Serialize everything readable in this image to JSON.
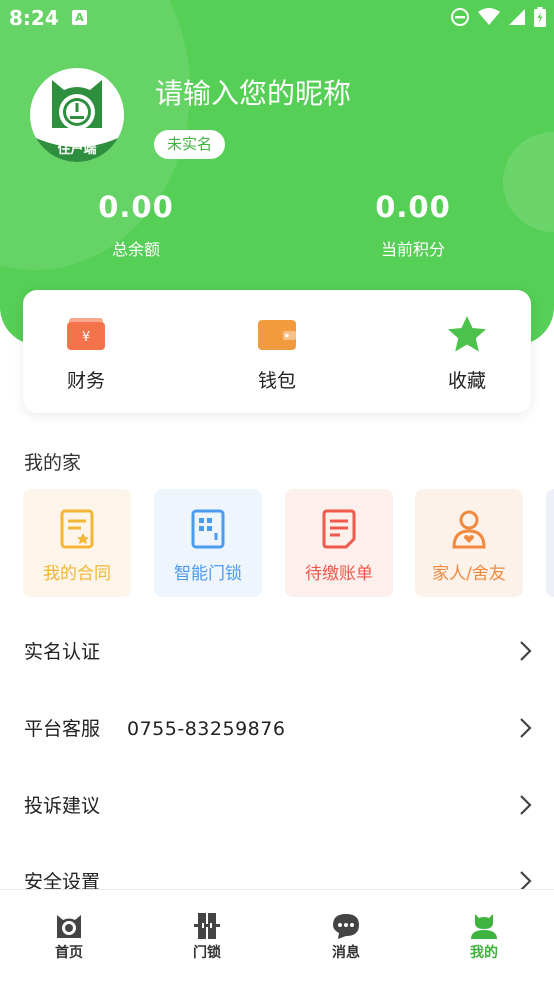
{
  "status": {
    "time": "8:24",
    "notice_icon": "A"
  },
  "profile": {
    "avatar_caption": "住户端",
    "nickname": "请输入您的昵称",
    "verify_badge": "未实名"
  },
  "stats": [
    {
      "value": "0.00",
      "label": "总余额"
    },
    {
      "value": "0.00",
      "label": "当前积分"
    }
  ],
  "quick_actions": [
    {
      "label": "财务",
      "icon": "finance-icon",
      "color": "#f5734b"
    },
    {
      "label": "钱包",
      "icon": "wallet-icon",
      "color": "#f19a3e"
    },
    {
      "label": "收藏",
      "icon": "star-icon",
      "color": "#4cc24c"
    }
  ],
  "my_home": {
    "title": "我的家",
    "tiles": [
      {
        "label": "我的合同",
        "icon": "contract-icon",
        "color": "#f2b636",
        "bg": "#fdf5ea"
      },
      {
        "label": "智能门锁",
        "icon": "door-lock-icon",
        "color": "#4a9cf0",
        "bg": "#eef5fd"
      },
      {
        "label": "待缴账单",
        "icon": "bill-icon",
        "color": "#ef5a4c",
        "bg": "#fdefec"
      },
      {
        "label": "家人/舍友",
        "icon": "family-icon",
        "color": "#f28a3e",
        "bg": "#fdf2ea"
      }
    ]
  },
  "menu": [
    {
      "label": "实名认证",
      "extra": ""
    },
    {
      "label": "平台客服",
      "extra": "0755-83259876"
    },
    {
      "label": "投诉建议",
      "extra": ""
    },
    {
      "label": "安全设置",
      "extra": ""
    }
  ],
  "tabs": [
    {
      "label": "首页",
      "icon": "home-cat-icon",
      "active": false
    },
    {
      "label": "门锁",
      "icon": "door-icon",
      "active": false
    },
    {
      "label": "消息",
      "icon": "message-icon",
      "active": false
    },
    {
      "label": "我的",
      "icon": "profile-icon",
      "active": true
    }
  ],
  "colors": {
    "brand": "#55cf55",
    "active_tab": "#3fb23f",
    "text": "#222222"
  }
}
